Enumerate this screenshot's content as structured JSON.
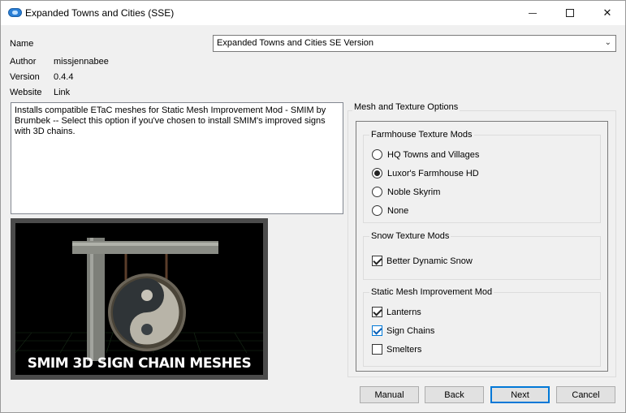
{
  "window": {
    "title": "Expanded Towns and Cities (SSE)",
    "controls": {
      "minimize": "minimize",
      "maximize": "maximize",
      "close": "✕"
    }
  },
  "info": {
    "name_label": "Name",
    "name_value": "Expanded Towns and Cities SE Version",
    "author_label": "Author",
    "author_value": "missjennabee",
    "version_label": "Version",
    "version_value": "0.4.4",
    "website_label": "Website",
    "website_value": "Link"
  },
  "description": "Installs compatible ETaC meshes for Static Mesh Improvement Mod - SMIM by Brumbek -- Select this option if you've chosen to install SMIM's improved signs with 3D chains.",
  "image": {
    "caption": "SMIM 3D SIGN CHAIN MESHES",
    "sign_text": ""
  },
  "options": {
    "title": "Mesh and Texture Options",
    "groups": [
      {
        "title": "Farmhouse Texture Mods",
        "type": "radio",
        "items": [
          {
            "label": "HQ Towns and Villages",
            "checked": false
          },
          {
            "label": "Luxor's Farmhouse HD",
            "checked": true
          },
          {
            "label": "Noble Skyrim",
            "checked": false
          },
          {
            "label": "None",
            "checked": false
          }
        ]
      },
      {
        "title": "Snow Texture Mods",
        "type": "checkbox",
        "items": [
          {
            "label": "Better Dynamic Snow",
            "checked": true
          }
        ]
      },
      {
        "title": "Static Mesh Improvement Mod",
        "type": "checkbox",
        "items": [
          {
            "label": "Lanterns",
            "checked": true
          },
          {
            "label": "Sign Chains",
            "checked": true
          },
          {
            "label": "Smelters",
            "checked": false
          }
        ]
      }
    ]
  },
  "buttons": {
    "manual": "Manual",
    "back": "Back",
    "next": "Next",
    "cancel": "Cancel"
  },
  "colors": {
    "accent": "#0078d7",
    "window_bg": "#f0f0f0",
    "image_bg": "#000000"
  }
}
